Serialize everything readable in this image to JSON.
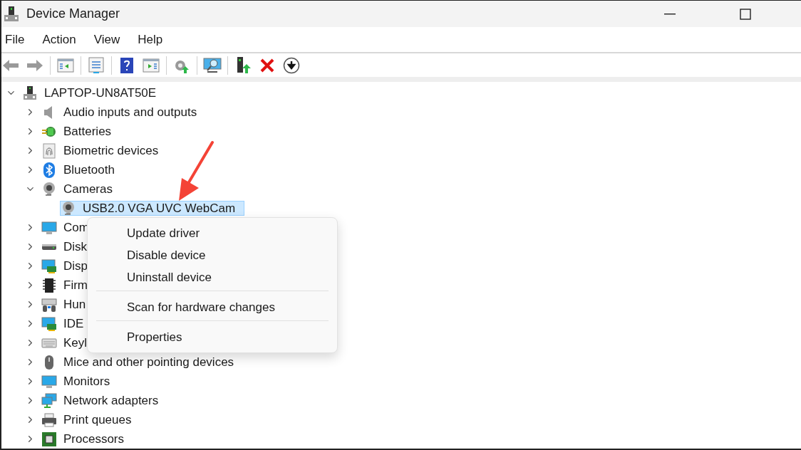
{
  "window": {
    "title": "Device Manager"
  },
  "menu_bar": [
    {
      "label": "File"
    },
    {
      "label": "Action"
    },
    {
      "label": "View"
    },
    {
      "label": "Help"
    }
  ],
  "toolbar": [
    {
      "kind": "back",
      "disabled": true
    },
    {
      "kind": "forward",
      "disabled": true
    },
    {
      "kind": "separator"
    },
    {
      "kind": "console-tree"
    },
    {
      "kind": "separator"
    },
    {
      "kind": "properties"
    },
    {
      "kind": "separator"
    },
    {
      "kind": "help"
    },
    {
      "kind": "action-pane"
    },
    {
      "kind": "separator"
    },
    {
      "kind": "scan"
    },
    {
      "kind": "separator"
    },
    {
      "kind": "monitor-search"
    },
    {
      "kind": "separator"
    },
    {
      "kind": "update"
    },
    {
      "kind": "remove"
    },
    {
      "kind": "download"
    }
  ],
  "tree": {
    "label": "LAPTOP-UN8AT50E",
    "kind": "computer",
    "expanded": true,
    "selected": false,
    "children": [
      {
        "label": "Audio inputs and outputs",
        "kind": "audio",
        "expanded": false,
        "selected": false
      },
      {
        "label": "Batteries",
        "kind": "battery",
        "expanded": false,
        "selected": false
      },
      {
        "label": "Biometric devices",
        "kind": "fingerprint",
        "expanded": false,
        "selected": false
      },
      {
        "label": "Bluetooth",
        "kind": "bluetooth",
        "expanded": false,
        "selected": false
      },
      {
        "label": "Cameras",
        "kind": "camera",
        "expanded": true,
        "selected": false,
        "children": [
          {
            "label": "USB2.0 VGA UVC WebCam",
            "kind": "camera",
            "selected": true
          }
        ]
      },
      {
        "label": "Com",
        "kind": "monitor",
        "expanded": false,
        "selected": false
      },
      {
        "label": "Disk",
        "kind": "disk",
        "expanded": false,
        "selected": false
      },
      {
        "label": "Disp",
        "kind": "display-adapter",
        "expanded": false,
        "selected": false
      },
      {
        "label": "Firm",
        "kind": "chip",
        "expanded": false,
        "selected": false
      },
      {
        "label": "Hun",
        "kind": "hid",
        "expanded": false,
        "selected": false
      },
      {
        "label": "IDE",
        "kind": "display-adapter",
        "expanded": false,
        "selected": false
      },
      {
        "label": "Keyl",
        "kind": "keyboard",
        "expanded": false,
        "selected": false
      },
      {
        "label": "Mice and other pointing devices",
        "kind": "mouse",
        "expanded": false,
        "selected": false
      },
      {
        "label": "Monitors",
        "kind": "monitor",
        "expanded": false,
        "selected": false
      },
      {
        "label": "Network adapters",
        "kind": "network",
        "expanded": false,
        "selected": false
      },
      {
        "label": "Print queues",
        "kind": "printer",
        "expanded": false,
        "selected": false
      },
      {
        "label": "Processors",
        "kind": "processor",
        "expanded": false,
        "selected": false
      }
    ]
  },
  "context_menu": {
    "groups": [
      [
        {
          "label": "Update driver"
        },
        {
          "label": "Disable device"
        },
        {
          "label": "Uninstall device"
        }
      ],
      [
        {
          "label": "Scan for hardware changes"
        }
      ],
      [
        {
          "label": "Properties"
        }
      ]
    ]
  },
  "annotation": {
    "kind": "arrow",
    "color": "#f44336"
  }
}
